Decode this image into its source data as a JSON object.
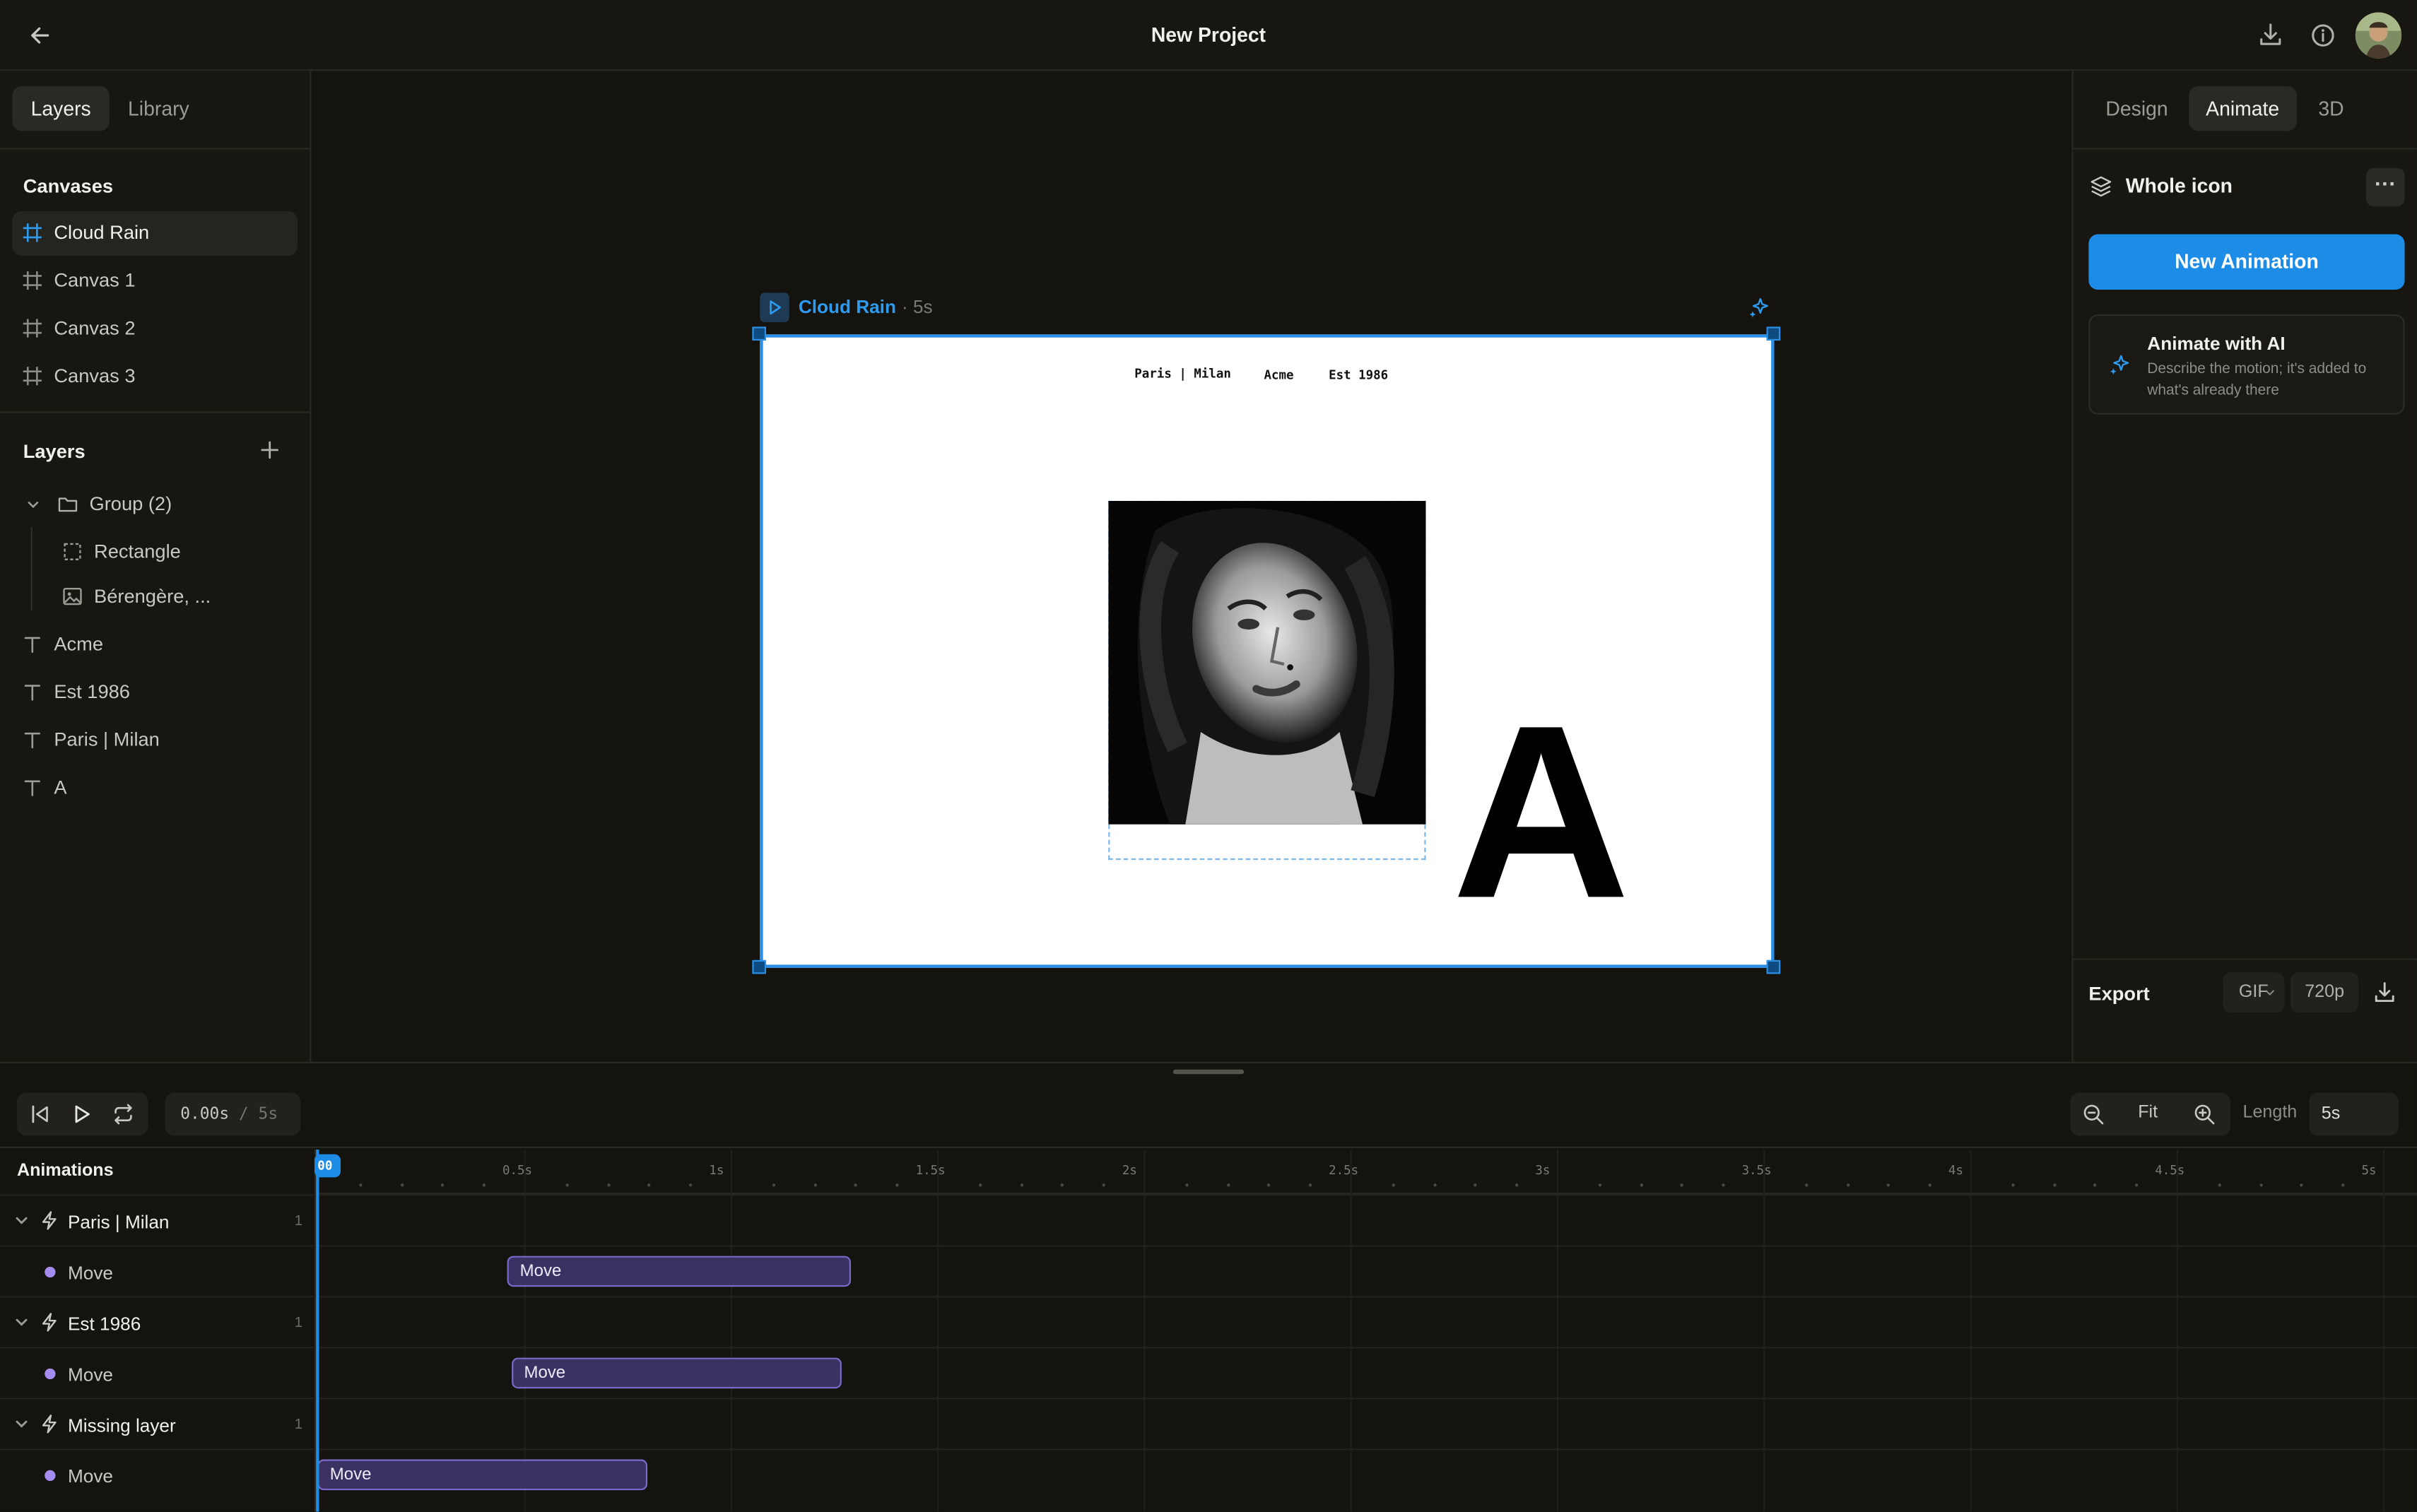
{
  "header": {
    "title": "New Project"
  },
  "left_panel": {
    "tabs": [
      {
        "label": "Layers",
        "active": true
      },
      {
        "label": "Library",
        "active": false
      }
    ],
    "canvases_title": "Canvases",
    "canvases": [
      {
        "label": "Cloud Rain",
        "active": true
      },
      {
        "label": "Canvas 1",
        "active": false
      },
      {
        "label": "Canvas 2",
        "active": false
      },
      {
        "label": "Canvas 3",
        "active": false
      }
    ],
    "layers_title": "Layers",
    "layers": [
      {
        "label": "Group (2)",
        "icon": "folder-icon"
      },
      {
        "label": "Rectangle",
        "icon": "rectangle-icon"
      },
      {
        "label": "Bérengère, ...",
        "icon": "image-icon"
      },
      {
        "label": "Acme",
        "icon": "text-icon"
      },
      {
        "label": "Est 1986",
        "icon": "text-icon"
      },
      {
        "label": "Paris | Milan",
        "icon": "text-icon"
      },
      {
        "label": "A",
        "icon": "text-icon"
      }
    ]
  },
  "stage": {
    "frame_name": "Cloud Rain",
    "frame_duration": "· 5s",
    "canvas_texts": {
      "paris": "Paris | Milan",
      "acme": "Acme",
      "est": "Est 1986",
      "big_letter": "A"
    }
  },
  "right_panel": {
    "tabs": [
      {
        "label": "Design",
        "active": false
      },
      {
        "label": "Animate",
        "active": true
      },
      {
        "label": "3D",
        "active": false
      }
    ],
    "target_label": "Whole icon",
    "more_label": "···",
    "new_animation_label": "New Animation",
    "ai_title": "Animate with AI",
    "ai_description": "Describe the motion; it's added to what's already there",
    "export_label": "Export",
    "export_format": "GIF",
    "export_resolution": "720p"
  },
  "timeline": {
    "current_time": "0.00s",
    "separator": "/",
    "total_time": "5s",
    "fit_label": "Fit",
    "length_label": "Length",
    "length_value": "5s",
    "animations_title": "Animations",
    "playhead_label": "00",
    "ruler": [
      "0.5s",
      "1s",
      "1.5s",
      "2s",
      "2.5s",
      "3s",
      "3.5s",
      "4s",
      "4.5s",
      "5s"
    ],
    "groups": [
      {
        "label": "Paris | Milan",
        "count": "1",
        "move_label": "Move",
        "block_label": "Move",
        "start": 0.46,
        "end": 1.29
      },
      {
        "label": "Est 1986",
        "count": "1",
        "move_label": "Move",
        "block_label": "Move",
        "start": 0.47,
        "end": 1.27
      },
      {
        "label": "Missing layer",
        "count": "1",
        "move_label": "Move",
        "block_label": "Move",
        "start": 0.0,
        "end": 0.8
      }
    ]
  },
  "colors": {
    "accent": "#1d8ce6",
    "block_fill": "#3b3263",
    "block_border": "#7b69c9",
    "background": "#14130e"
  }
}
